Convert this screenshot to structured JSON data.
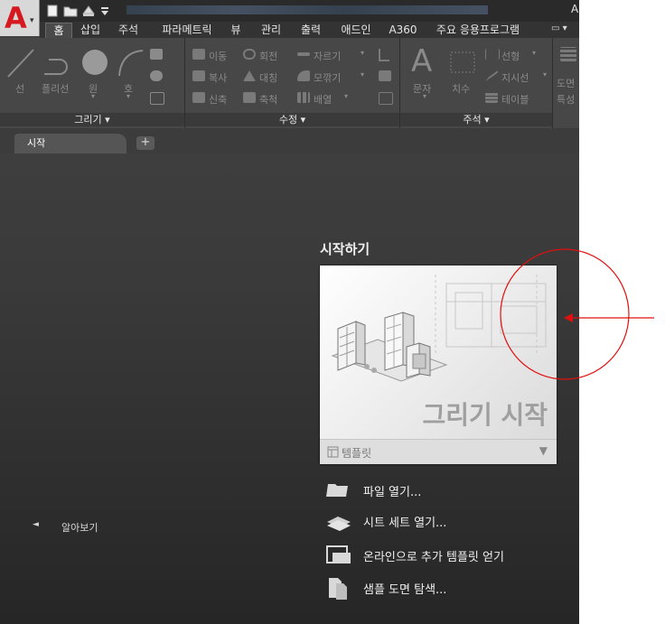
{
  "titlebar": {
    "app_title": "A"
  },
  "ribbon_tabs": [
    {
      "label": "홈"
    },
    {
      "label": "삽입"
    },
    {
      "label": "주석"
    },
    {
      "label": "파라메트릭"
    },
    {
      "label": "뷰"
    },
    {
      "label": "관리"
    },
    {
      "label": "출력"
    },
    {
      "label": "애드인"
    },
    {
      "label": "A360"
    },
    {
      "label": "주요 응용프로그램"
    }
  ],
  "draw_panel": {
    "title": "그리기 ▾",
    "tools": [
      {
        "label": "선"
      },
      {
        "label": "폴리선"
      },
      {
        "label": "원"
      },
      {
        "label": "호"
      }
    ]
  },
  "modify_panel": {
    "title": "수정 ▾",
    "tools": [
      {
        "label": "이동"
      },
      {
        "label": "회전"
      },
      {
        "label": "자르기"
      },
      {
        "label": "복사"
      },
      {
        "label": "대칭"
      },
      {
        "label": "모깎기"
      },
      {
        "label": "신축"
      },
      {
        "label": "축척"
      },
      {
        "label": "배열"
      }
    ]
  },
  "annotation_panel": {
    "title": "주석 ▾",
    "tools": [
      {
        "label": "문자"
      },
      {
        "label": "치수"
      },
      {
        "label": "선형"
      },
      {
        "label": "지시선"
      },
      {
        "label": "테이블"
      }
    ]
  },
  "layers_panel": {
    "labels": [
      "도면",
      "특성"
    ]
  },
  "doc_tabs": {
    "start_tab": "시작",
    "add_tab": "+"
  },
  "start_page": {
    "heading": "시작하기",
    "start_drawing": "그리기 시작",
    "template": {
      "label": "템플릿",
      "dropdown": "▼"
    },
    "actions": [
      {
        "label": "파일 열기..."
      },
      {
        "label": "시트 세트 열기..."
      },
      {
        "label": "온라인으로 추가 템플릿 얻기"
      },
      {
        "label": "샘플 도면 탐색..."
      }
    ],
    "learn": {
      "arrow": "◄",
      "label": "알아보기"
    }
  },
  "colors": {
    "accent_red": "#d5191f",
    "annotation_red": "#e01010",
    "ribbon": "#474747"
  }
}
